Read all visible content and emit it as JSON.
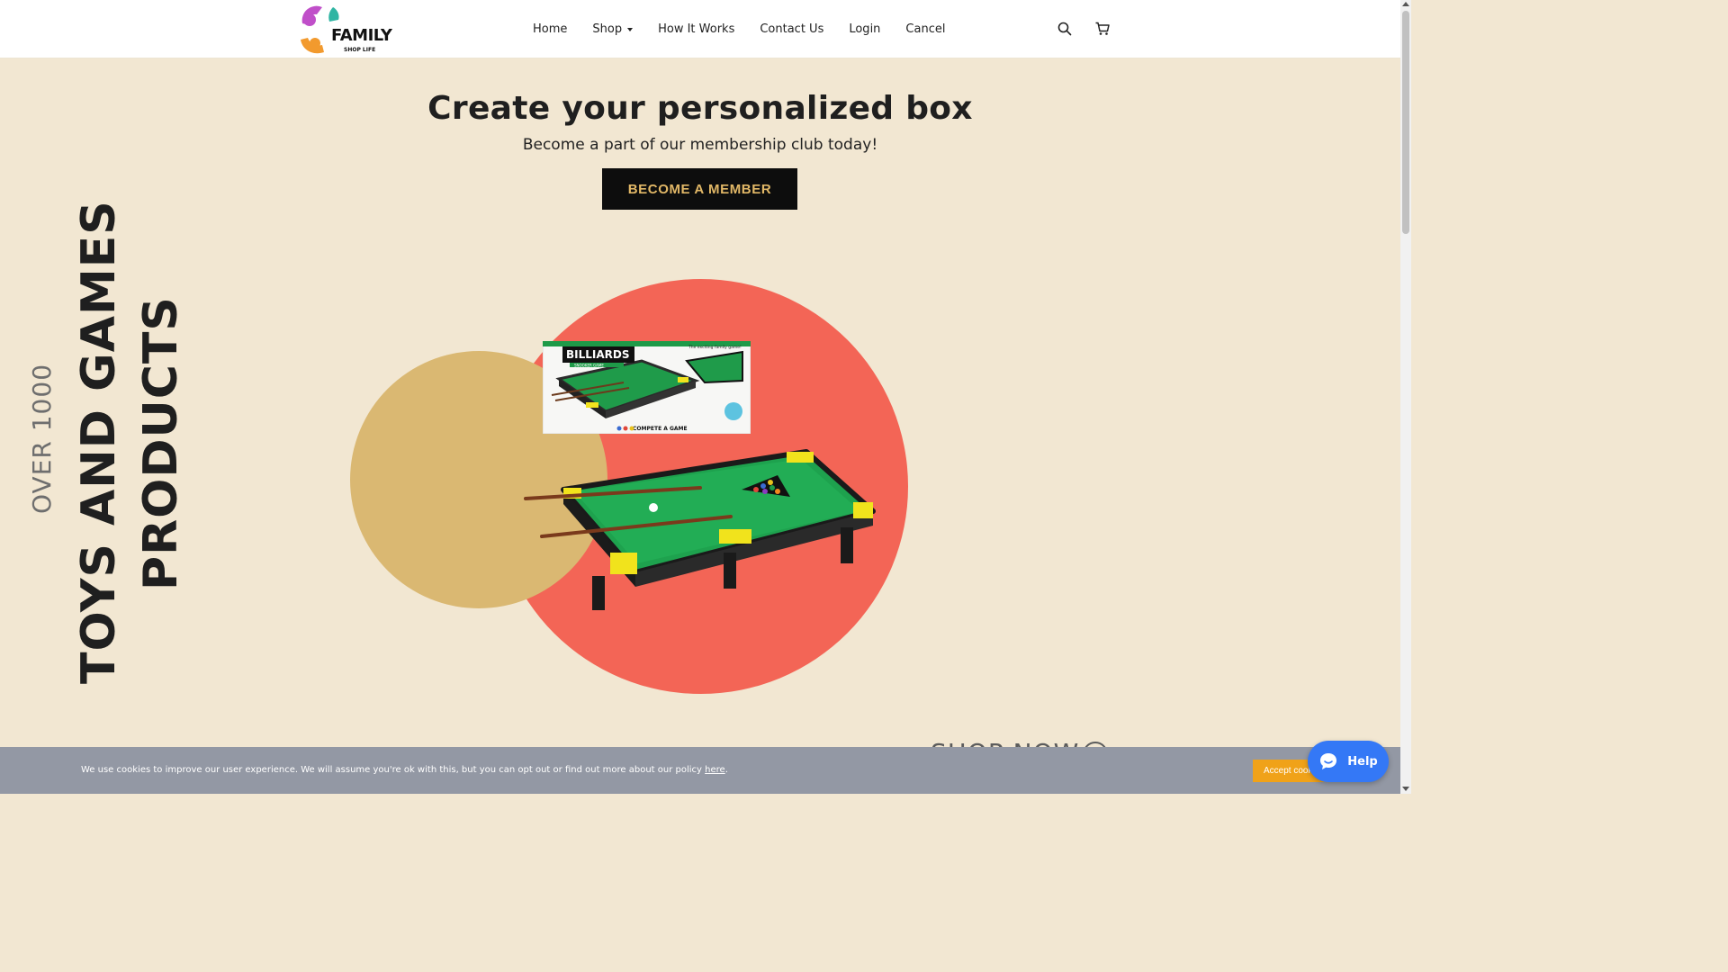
{
  "brand": {
    "name": "FAMILY",
    "tagline": "SHOP LIFE"
  },
  "nav": {
    "items": [
      {
        "label": "Home"
      },
      {
        "label": "Shop",
        "has_dropdown": true
      },
      {
        "label": "How It Works"
      },
      {
        "label": "Contact Us"
      },
      {
        "label": "Login"
      },
      {
        "label": "Cancel"
      }
    ],
    "icons": [
      "search-icon",
      "cart-icon"
    ]
  },
  "hero": {
    "title": "Create your personalized box",
    "subtitle": "Become a part of our membership club today!",
    "cta_label": "BECOME A MEMBER"
  },
  "side_text": {
    "over": "OVER 1000",
    "line1": "TOYS AND GAMES",
    "line2": "PRODUCTS"
  },
  "product": {
    "box_title": "BILLIARDS",
    "box_subtitle": "SNOOKER GAME",
    "box_tagline": "The exciting family game!",
    "box_footer": "COMPETE A GAME"
  },
  "shop_now": {
    "label": "SHOP NOW"
  },
  "cookie": {
    "text_before": "We use cookies to improve our user experience. We will assume you're ok with this, but you can opt out or find out more about our policy ",
    "link_text": "here",
    "text_after": ".",
    "accept_label": "Accept cookies"
  },
  "help": {
    "label": "Help"
  },
  "colors": {
    "background": "#f2e7d2",
    "cta_bg": "#0d0d0d",
    "cta_text": "#e2b867",
    "circle_red": "#f36556",
    "circle_gold": "#dab872",
    "cookie_bar": "#9398a4",
    "accept": "#f0a219",
    "help": "#3478f6"
  }
}
